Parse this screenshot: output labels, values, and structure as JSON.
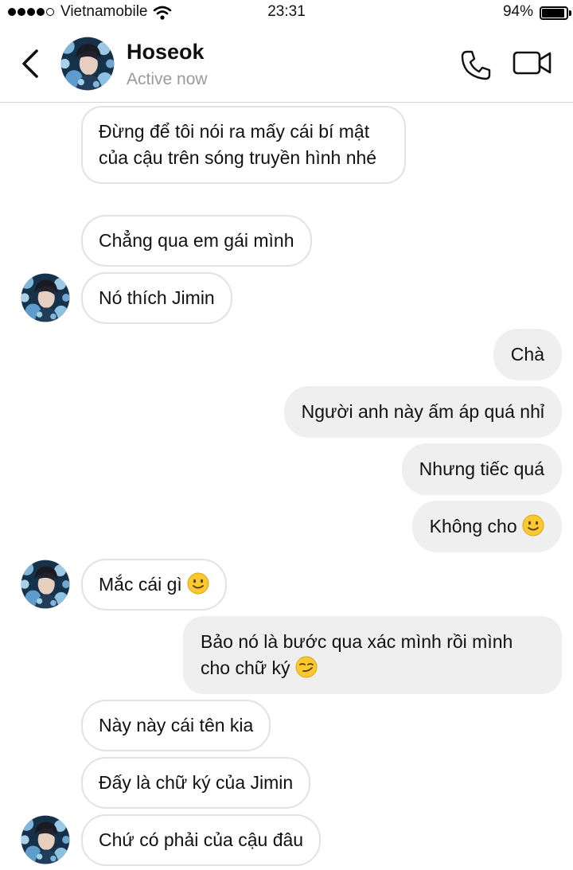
{
  "status_bar": {
    "carrier": "Vietnamobile",
    "time": "23:31",
    "battery_percent": "94%",
    "battery_level": 0.94,
    "signal_bars": 4,
    "signal_total": 5
  },
  "header": {
    "contact_name": "Hoseok",
    "contact_status": "Active now",
    "back_icon": "chevron-left-icon",
    "call_icon": "phone-icon",
    "video_icon": "video-camera-icon"
  },
  "messages": [
    {
      "from": "them",
      "text": "Đừng để tôi nói ra mấy cái bí mật của cậu trên sóng truyền hình nhé"
    },
    {
      "from": "them",
      "text": "Chẳng qua em gái mình"
    },
    {
      "from": "them",
      "text": "Nó thích Jimin"
    },
    {
      "from": "me",
      "text": "Chà"
    },
    {
      "from": "me",
      "text": "Người anh này ấm áp quá nhỉ"
    },
    {
      "from": "me",
      "text": "Nhưng tiếc quá"
    },
    {
      "from": "me",
      "text": "Không cho",
      "emoji": "slight-smile"
    },
    {
      "from": "them",
      "text": "Mắc cái gì",
      "emoji": "slight-smile"
    },
    {
      "from": "me",
      "text": "Bảo nó là bước qua xác mình rồi mình cho chữ ký",
      "emoji": "smirk"
    },
    {
      "from": "them",
      "text": "Này này cái tên kia"
    },
    {
      "from": "them",
      "text": "Đấy là chữ ký của Jimin"
    },
    {
      "from": "them",
      "text": "Chứ có phải của cậu đâu"
    }
  ],
  "colors": {
    "incoming_border": "#e2e2e2",
    "outgoing_bg": "#efefef",
    "status_gray": "#9a9a9a",
    "emoji_yellow": "#f9c92e"
  }
}
